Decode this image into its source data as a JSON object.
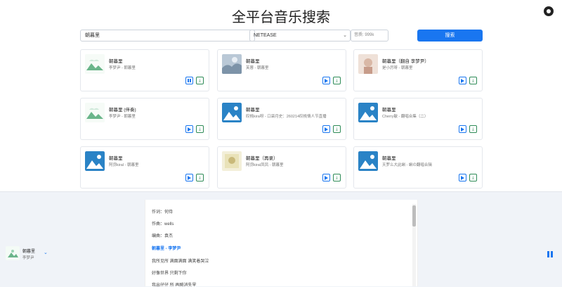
{
  "header": {
    "title": "全平台音乐搜索"
  },
  "search": {
    "value": "朝暮里",
    "source": "NETEASE",
    "quality": "音质: 999k",
    "button_label": "搜索"
  },
  "results": [
    {
      "title": "朝暮里",
      "artist": "李梦尹 - 朝暮里",
      "thumb": "cloud",
      "state": "paused"
    },
    {
      "title": "朝暮里",
      "artist": "芙蓉 - 朝暮里",
      "thumb": "misty",
      "state": "play"
    },
    {
      "title": "朝暮里（翻自 李梦尹）",
      "artist": "是小厉呀 - 朝暮里",
      "thumb": "pink",
      "state": "play"
    },
    {
      "title": "朝暮里 (伴奏)",
      "artist": "李梦尹 - 朝暮里",
      "thumb": "cloud",
      "state": "play"
    },
    {
      "title": "朝暮里",
      "artist": "叹桃kira呀 - 口袋月史：260214叹桃情人节直播",
      "thumb": "placeholder",
      "state": "play"
    },
    {
      "title": "朝暮里",
      "artist": "Cherry敏 - 翻唱合集（二）",
      "thumb": "placeholder",
      "state": "play"
    },
    {
      "title": "朝暮里",
      "artist": "阿弥kiral - 朝暮里",
      "thumb": "placeholder",
      "state": "play"
    },
    {
      "title": "朝暮里（再录）",
      "artist": "阿弥kiral凤凤 - 朝暮里",
      "thumb": "yellow",
      "state": "play"
    },
    {
      "title": "朝暮里",
      "artist": "天罗么大此蝌 - 蝌の翻唱合辑",
      "thumb": "placeholder",
      "state": "play"
    }
  ],
  "player": {
    "title": "朝暮里",
    "artist": "李梦尹",
    "lyrics": [
      {
        "text": "作词：何侍",
        "active": false
      },
      {
        "text": "作曲：wells",
        "active": false
      },
      {
        "text": "编曲：袁杰",
        "active": false
      },
      {
        "text": "朝暮里 - 李梦尹",
        "active": true
      },
      {
        "text": "我所见所 满面满面 满笑着哭泣",
        "active": false
      },
      {
        "text": "好像世界 只剩下你",
        "active": false
      },
      {
        "text": "我出仔仔 所 再瞬消失里",
        "active": false
      }
    ]
  },
  "colors": {
    "accent": "#1976f0",
    "download": "#2e8b57",
    "player_bg": "#f0f3f8"
  }
}
